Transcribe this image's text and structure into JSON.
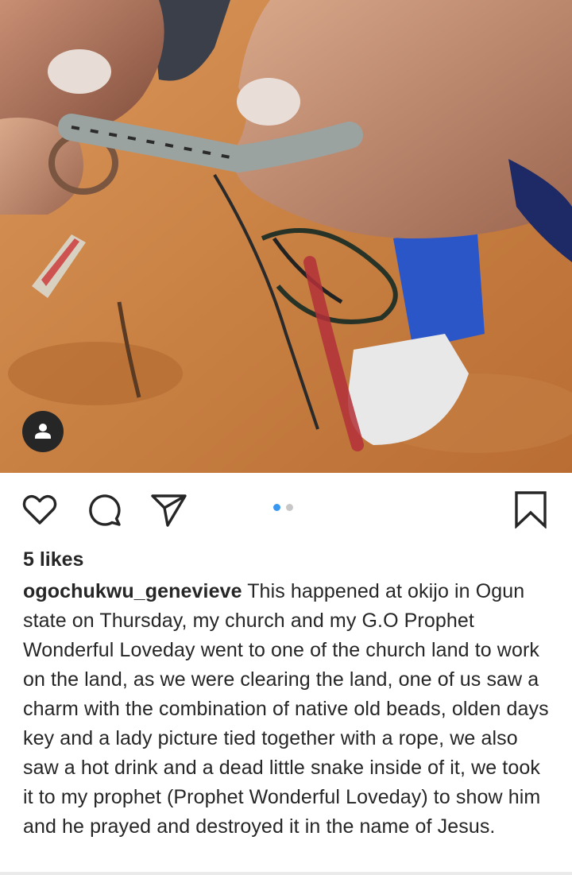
{
  "post": {
    "image_description_icon": "user-tag-icon",
    "likes": "5 likes",
    "username": "ogochukwu_genevieve",
    "caption": " This happened at okijo in Ogun state on Thursday, my church and my G.O Prophet Wonderful Loveday went to one of the church land to work on the land, as we were clearing the land, one of us saw a charm with the combination of native old beads, olden days key and a lady picture tied together with a rope, we also saw a hot drink and a dead little snake inside of it, we took it to my prophet (Prophet Wonderful Loveday) to show him and he prayed and destroyed it in the name of Jesus."
  },
  "actions": {
    "icons": [
      "heart-icon",
      "comment-icon",
      "share-icon",
      "bookmark-icon"
    ]
  },
  "carousel": {
    "total": 2,
    "active": 1,
    "active_color": "#3897f0",
    "inactive_color": "#c7c7c7"
  }
}
